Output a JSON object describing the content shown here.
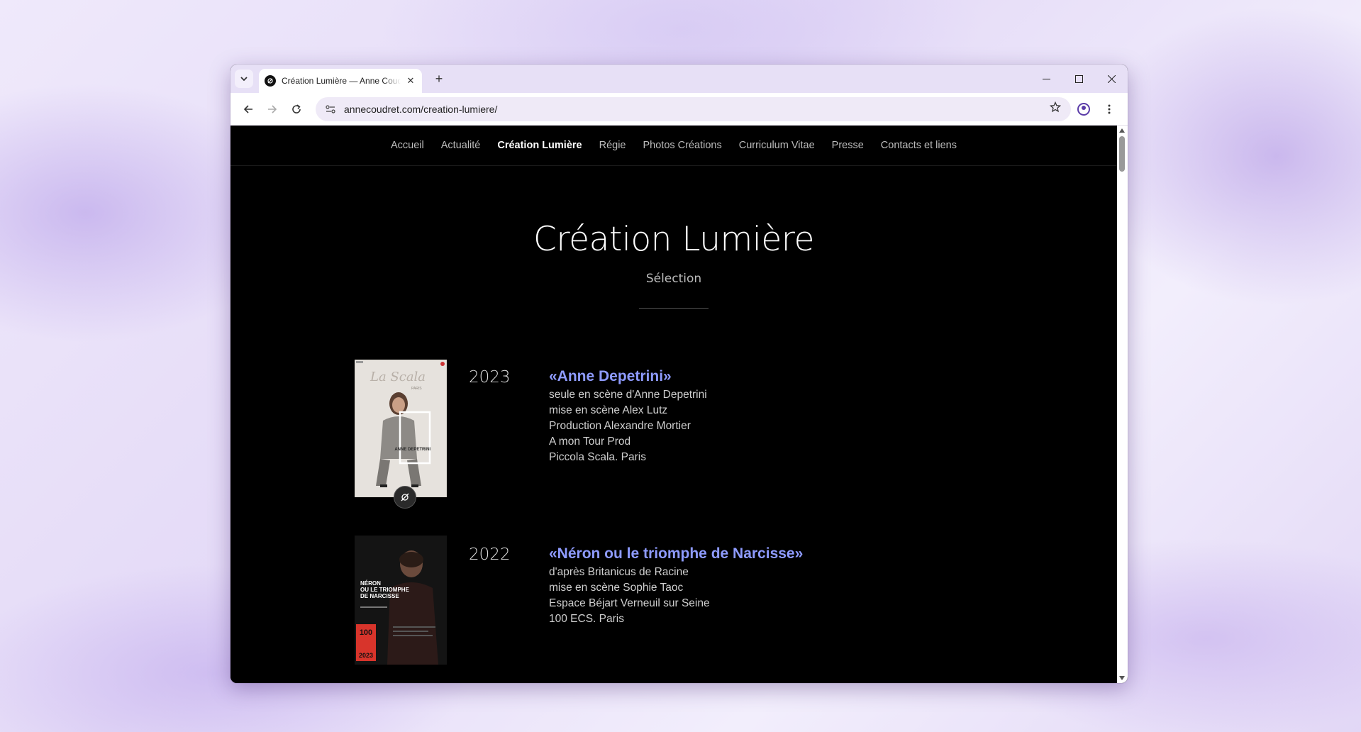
{
  "browser": {
    "tab_title": "Création Lumière — Anne Coudret",
    "tab_close": "✕",
    "new_tab": "+",
    "url": "annecoudret.com/creation-lumiere/",
    "icons": {
      "tab_search": "chevron-down-icon",
      "back": "back-arrow-icon",
      "forward": "forward-arrow-icon",
      "reload": "reload-icon",
      "site_info": "site-info-icon",
      "bookmark": "star-icon",
      "profile": "profile-icon",
      "menu": "kebab-menu-icon"
    }
  },
  "site": {
    "nav": [
      {
        "label": "Accueil",
        "active": false
      },
      {
        "label": "Actualité",
        "active": false
      },
      {
        "label": "Création Lumière",
        "active": true
      },
      {
        "label": "Régie",
        "active": false
      },
      {
        "label": "Photos Créations",
        "active": false
      },
      {
        "label": "Curriculum Vitae",
        "active": false
      },
      {
        "label": "Presse",
        "active": false
      },
      {
        "label": "Contacts et liens",
        "active": false
      }
    ],
    "title": "Création Lumière",
    "subtitle": "Sélection"
  },
  "entries": [
    {
      "year": "2023",
      "title": "«Anne Depetrini»",
      "credits": [
        "seule en scène d'Anne Depetrini",
        "mise en scène Alex Lutz",
        "Production Alexandre Mortier",
        "A mon Tour Prod",
        "Piccola Scala. Paris"
      ],
      "poster": {
        "top_text": "La Scala",
        "sub_text": "PARIS",
        "name": "ANNE DEPETRINI"
      }
    },
    {
      "year": "2022",
      "title": "«Néron ou le triomphe de Narcisse»",
      "credits": [
        "d'après Britanicus de Racine",
        "mise en scène Sophie Taoc",
        "Espace Béjart Verneuil sur Seine",
        "100 ECS. Paris"
      ],
      "poster": {
        "headline": "NÉRON OU LE TRIOMPHE DE NARCISSE",
        "badge": "100",
        "year": "2023"
      }
    }
  ],
  "colors": {
    "accent_title": "#8e9bff",
    "page_bg": "#000000",
    "tabbar_bg": "#e7e0f6"
  }
}
